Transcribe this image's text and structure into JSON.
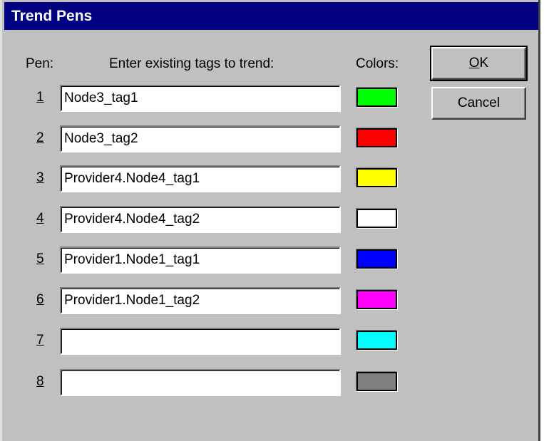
{
  "dialog": {
    "title": "Trend Pens",
    "pen_header": "Pen:",
    "tags_header": "Enter existing tags to trend:",
    "colors_header": "Colors:",
    "ok_label": "OK",
    "cancel_label": "Cancel"
  },
  "pens": [
    {
      "number": "1",
      "tag": "Node3_tag1",
      "color": "#00ff00"
    },
    {
      "number": "2",
      "tag": "Node3_tag2",
      "color": "#ff0000"
    },
    {
      "number": "3",
      "tag": "Provider4.Node4_tag1",
      "color": "#ffff00"
    },
    {
      "number": "4",
      "tag": "Provider4.Node4_tag2",
      "color": "#ffffff"
    },
    {
      "number": "5",
      "tag": "Provider1.Node1_tag1",
      "color": "#0000ff"
    },
    {
      "number": "6",
      "tag": "Provider1.Node1_tag2",
      "color": "#ff00ff"
    },
    {
      "number": "7",
      "tag": "",
      "color": "#00ffff"
    },
    {
      "number": "8",
      "tag": "",
      "color": "#808080"
    }
  ]
}
